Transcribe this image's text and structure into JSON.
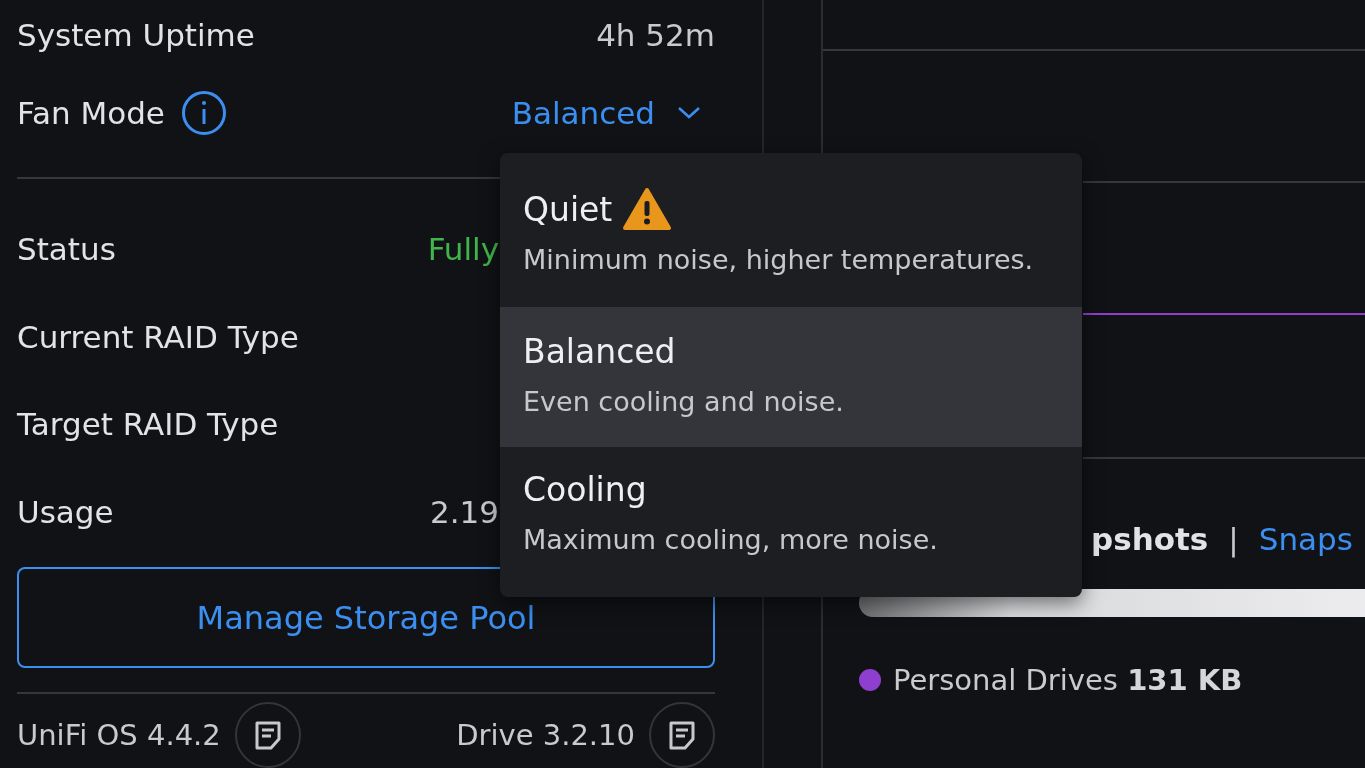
{
  "details": {
    "rows": [
      {
        "label": "System Uptime",
        "value": "4h 52m",
        "kind": "text"
      },
      {
        "label": "Fan Mode",
        "value": "Balanced",
        "kind": "dropdown",
        "expanded": true
      },
      {
        "label": "Status",
        "value": "Fully",
        "kind": "status"
      },
      {
        "label": "Current RAID Type",
        "kind": "text"
      },
      {
        "label": "Target RAID Type",
        "kind": "text"
      },
      {
        "label": "Usage",
        "value": "2.19",
        "kind": "text"
      }
    ],
    "button": "Manage Storage Pool",
    "versions": [
      {
        "label": "UniFi OS 4.4.2"
      },
      {
        "label": "Drive 3.2.10"
      }
    ]
  },
  "fan_menu": [
    {
      "title": "Quiet",
      "description": "Minimum noise, higher temperatures.",
      "warning": true,
      "selected": false
    },
    {
      "title": "Balanced",
      "description": "Even cooling and noise.",
      "warning": false,
      "selected": true
    },
    {
      "title": "Cooling",
      "description": "Maximum cooling, more noise.",
      "warning": false,
      "selected": false
    }
  ],
  "snapshots": {
    "tabs": [
      {
        "label": "pshots",
        "selected": true
      },
      {
        "label": "Snaps",
        "selected": false
      }
    ],
    "separator": "|",
    "usage": {
      "level": 1
    },
    "legend": [
      {
        "name": "Personal Drives",
        "value": "131 KB",
        "color": "#8e3fcf"
      }
    ]
  }
}
